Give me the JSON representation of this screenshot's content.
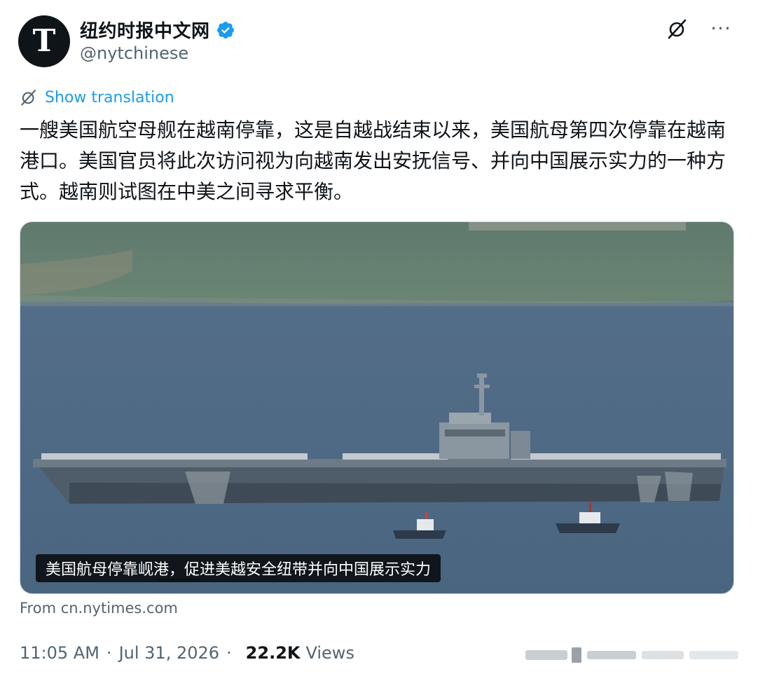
{
  "account": {
    "display_name": "纽约时报中文网",
    "handle": "@nytchinese",
    "avatar_letter": "T",
    "verified": true
  },
  "actions": {
    "grok_icon": "grok-icon",
    "more_label": "···"
  },
  "translation": {
    "label": "Show translation"
  },
  "tweet": {
    "text": "一艘美国航空母舰在越南停靠，这是自越战结束以来，美国航母第四次停靠在越南港口。美国官员将此次访问视为向越南发出安抚信号、并向中国展示实力的一种方式。越南则试图在中美之间寻求平衡。"
  },
  "media": {
    "caption": "美国航母停靠岘港，促进美越安全纽带并向中国展示实力"
  },
  "card": {
    "source": "From cn.nytimes.com"
  },
  "meta": {
    "time": "11:05 AM",
    "date": "Jul 31, 2026",
    "views_count": "22.2K",
    "views_label": "Views"
  },
  "colors": {
    "accent": "#1d9bf0",
    "text": "#0f1419",
    "secondary": "#536471"
  }
}
